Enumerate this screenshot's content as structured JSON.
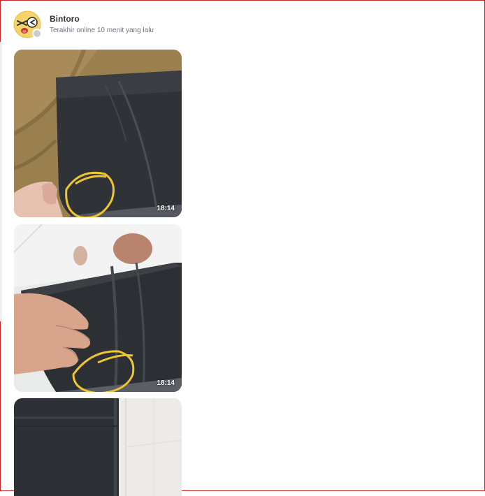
{
  "chat": {
    "user_name": "Bintoro",
    "user_status": "Terakhir online 10 menit yang lalu"
  },
  "messages": [
    {
      "type": "image",
      "time": "18:14",
      "subject": "black tablet case on brown fabric with yellow circled corner"
    },
    {
      "type": "image",
      "time": "18:14",
      "subject": "hand holding black tablet case with yellow circled fold"
    },
    {
      "type": "image",
      "time": "",
      "subject": "black tablet case on light tiles"
    }
  ],
  "colors": {
    "frame_border": "#c62828",
    "name_text": "#31353b",
    "status_text": "#6d7588",
    "annotation_yellow": "#f0c52e"
  }
}
